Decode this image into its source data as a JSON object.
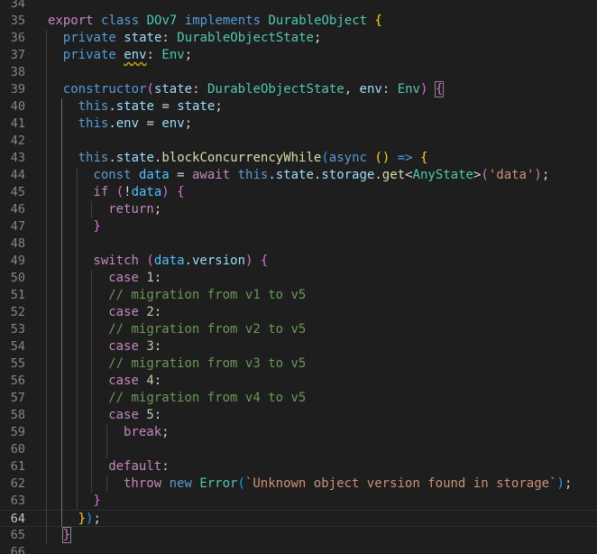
{
  "colors": {
    "background": "#1e1e1e",
    "line_number": "#858585",
    "line_number_active": "#c6c6c6",
    "keyword_blue": "#569cd6",
    "control_purple": "#c586c0",
    "type_teal": "#4ec9b0",
    "variable_lightblue": "#9cdcfe",
    "function_yellow": "#dcdcaa",
    "string_orange": "#ce9178",
    "number_green": "#b5cea8",
    "comment_green": "#6a9955",
    "bracket_gold": "#ffd700",
    "bracket_pink": "#da70d6",
    "bracket_blue": "#179fff",
    "plain": "#d4d4d4",
    "warning_squiggle": "#cca700"
  },
  "editor": {
    "active_line": 64,
    "lines": [
      {
        "n": "34",
        "indent": 0,
        "tokens": []
      },
      {
        "n": "35",
        "indent": 0,
        "tokens": [
          {
            "t": "export",
            "c": "#c586c0"
          },
          {
            "t": " ",
            "c": "#d4d4d4"
          },
          {
            "t": "class",
            "c": "#569cd6"
          },
          {
            "t": " ",
            "c": "#d4d4d4"
          },
          {
            "t": "DOv7",
            "c": "#4ec9b0"
          },
          {
            "t": " ",
            "c": "#d4d4d4"
          },
          {
            "t": "implements",
            "c": "#569cd6"
          },
          {
            "t": " ",
            "c": "#d4d4d4"
          },
          {
            "t": "DurableObject",
            "c": "#4ec9b0"
          },
          {
            "t": " ",
            "c": "#d4d4d4"
          },
          {
            "t": "{",
            "c": "#ffd700"
          }
        ]
      },
      {
        "n": "36",
        "indent": 1,
        "tokens": [
          {
            "t": "private",
            "c": "#569cd6"
          },
          {
            "t": " ",
            "c": "#d4d4d4"
          },
          {
            "t": "state",
            "c": "#9cdcfe"
          },
          {
            "t": ": ",
            "c": "#d4d4d4"
          },
          {
            "t": "DurableObjectState",
            "c": "#4ec9b0"
          },
          {
            "t": ";",
            "c": "#d4d4d4"
          }
        ]
      },
      {
        "n": "37",
        "indent": 1,
        "tokens": [
          {
            "t": "private",
            "c": "#569cd6"
          },
          {
            "t": " ",
            "c": "#d4d4d4"
          },
          {
            "t": "env",
            "c": "#9cdcfe",
            "squiggle": true
          },
          {
            "t": ": ",
            "c": "#d4d4d4"
          },
          {
            "t": "Env",
            "c": "#4ec9b0"
          },
          {
            "t": ";",
            "c": "#d4d4d4"
          }
        ]
      },
      {
        "n": "38",
        "indent": 1,
        "tokens": []
      },
      {
        "n": "39",
        "indent": 1,
        "tokens": [
          {
            "t": "constructor",
            "c": "#569cd6"
          },
          {
            "t": "(",
            "c": "#da70d6"
          },
          {
            "t": "state",
            "c": "#9cdcfe"
          },
          {
            "t": ": ",
            "c": "#d4d4d4"
          },
          {
            "t": "DurableObjectState",
            "c": "#4ec9b0"
          },
          {
            "t": ", ",
            "c": "#d4d4d4"
          },
          {
            "t": "env",
            "c": "#9cdcfe"
          },
          {
            "t": ": ",
            "c": "#d4d4d4"
          },
          {
            "t": "Env",
            "c": "#4ec9b0"
          },
          {
            "t": ")",
            "c": "#da70d6"
          },
          {
            "t": " ",
            "c": "#d4d4d4"
          },
          {
            "t": "{",
            "c": "#da70d6",
            "match": true
          }
        ]
      },
      {
        "n": "40",
        "indent": 2,
        "tokens": [
          {
            "t": "this",
            "c": "#569cd6"
          },
          {
            "t": ".",
            "c": "#d4d4d4"
          },
          {
            "t": "state",
            "c": "#9cdcfe"
          },
          {
            "t": " = ",
            "c": "#d4d4d4"
          },
          {
            "t": "state",
            "c": "#9cdcfe"
          },
          {
            "t": ";",
            "c": "#d4d4d4"
          }
        ]
      },
      {
        "n": "41",
        "indent": 2,
        "tokens": [
          {
            "t": "this",
            "c": "#569cd6"
          },
          {
            "t": ".",
            "c": "#d4d4d4"
          },
          {
            "t": "env",
            "c": "#9cdcfe"
          },
          {
            "t": " = ",
            "c": "#d4d4d4"
          },
          {
            "t": "env",
            "c": "#9cdcfe"
          },
          {
            "t": ";",
            "c": "#d4d4d4"
          }
        ]
      },
      {
        "n": "42",
        "indent": 2,
        "tokens": []
      },
      {
        "n": "43",
        "indent": 2,
        "tokens": [
          {
            "t": "this",
            "c": "#569cd6"
          },
          {
            "t": ".",
            "c": "#d4d4d4"
          },
          {
            "t": "state",
            "c": "#9cdcfe"
          },
          {
            "t": ".",
            "c": "#d4d4d4"
          },
          {
            "t": "blockConcurrencyWhile",
            "c": "#dcdcaa"
          },
          {
            "t": "(",
            "c": "#179fff"
          },
          {
            "t": "async",
            "c": "#569cd6"
          },
          {
            "t": " ",
            "c": "#d4d4d4"
          },
          {
            "t": "()",
            "c": "#ffd700"
          },
          {
            "t": " ",
            "c": "#d4d4d4"
          },
          {
            "t": "=>",
            "c": "#569cd6"
          },
          {
            "t": " ",
            "c": "#d4d4d4"
          },
          {
            "t": "{",
            "c": "#ffd700"
          }
        ]
      },
      {
        "n": "44",
        "indent": 3,
        "tokens": [
          {
            "t": "const",
            "c": "#569cd6"
          },
          {
            "t": " ",
            "c": "#d4d4d4"
          },
          {
            "t": "data",
            "c": "#4fc1ff"
          },
          {
            "t": " = ",
            "c": "#d4d4d4"
          },
          {
            "t": "await",
            "c": "#c586c0"
          },
          {
            "t": " ",
            "c": "#d4d4d4"
          },
          {
            "t": "this",
            "c": "#569cd6"
          },
          {
            "t": ".",
            "c": "#d4d4d4"
          },
          {
            "t": "state",
            "c": "#9cdcfe"
          },
          {
            "t": ".",
            "c": "#d4d4d4"
          },
          {
            "t": "storage",
            "c": "#9cdcfe"
          },
          {
            "t": ".",
            "c": "#d4d4d4"
          },
          {
            "t": "get",
            "c": "#dcdcaa"
          },
          {
            "t": "<",
            "c": "#d4d4d4"
          },
          {
            "t": "AnyState",
            "c": "#4ec9b0"
          },
          {
            "t": ">",
            "c": "#d4d4d4"
          },
          {
            "t": "(",
            "c": "#da70d6"
          },
          {
            "t": "'data'",
            "c": "#ce9178"
          },
          {
            "t": ")",
            "c": "#da70d6"
          },
          {
            "t": ";",
            "c": "#d4d4d4"
          }
        ]
      },
      {
        "n": "45",
        "indent": 3,
        "tokens": [
          {
            "t": "if",
            "c": "#c586c0"
          },
          {
            "t": " ",
            "c": "#d4d4d4"
          },
          {
            "t": "(",
            "c": "#da70d6"
          },
          {
            "t": "!",
            "c": "#d4d4d4"
          },
          {
            "t": "data",
            "c": "#4fc1ff"
          },
          {
            "t": ")",
            "c": "#da70d6"
          },
          {
            "t": " ",
            "c": "#d4d4d4"
          },
          {
            "t": "{",
            "c": "#da70d6"
          }
        ]
      },
      {
        "n": "46",
        "indent": 4,
        "tokens": [
          {
            "t": "return",
            "c": "#c586c0"
          },
          {
            "t": ";",
            "c": "#d4d4d4"
          }
        ]
      },
      {
        "n": "47",
        "indent": 3,
        "tokens": [
          {
            "t": "}",
            "c": "#da70d6"
          }
        ]
      },
      {
        "n": "48",
        "indent": 3,
        "tokens": []
      },
      {
        "n": "49",
        "indent": 3,
        "tokens": [
          {
            "t": "switch",
            "c": "#c586c0"
          },
          {
            "t": " ",
            "c": "#d4d4d4"
          },
          {
            "t": "(",
            "c": "#da70d6"
          },
          {
            "t": "data",
            "c": "#4fc1ff"
          },
          {
            "t": ".",
            "c": "#d4d4d4"
          },
          {
            "t": "version",
            "c": "#9cdcfe"
          },
          {
            "t": ")",
            "c": "#da70d6"
          },
          {
            "t": " ",
            "c": "#d4d4d4"
          },
          {
            "t": "{",
            "c": "#da70d6"
          }
        ]
      },
      {
        "n": "50",
        "indent": 4,
        "tokens": [
          {
            "t": "case",
            "c": "#c586c0"
          },
          {
            "t": " ",
            "c": "#d4d4d4"
          },
          {
            "t": "1",
            "c": "#b5cea8"
          },
          {
            "t": ":",
            "c": "#d4d4d4"
          }
        ]
      },
      {
        "n": "51",
        "indent": 4,
        "tokens": [
          {
            "t": "// migration from v1 to v5",
            "c": "#6a9955"
          }
        ]
      },
      {
        "n": "52",
        "indent": 4,
        "tokens": [
          {
            "t": "case",
            "c": "#c586c0"
          },
          {
            "t": " ",
            "c": "#d4d4d4"
          },
          {
            "t": "2",
            "c": "#b5cea8"
          },
          {
            "t": ":",
            "c": "#d4d4d4"
          }
        ]
      },
      {
        "n": "53",
        "indent": 4,
        "tokens": [
          {
            "t": "// migration from v2 to v5",
            "c": "#6a9955"
          }
        ]
      },
      {
        "n": "54",
        "indent": 4,
        "tokens": [
          {
            "t": "case",
            "c": "#c586c0"
          },
          {
            "t": " ",
            "c": "#d4d4d4"
          },
          {
            "t": "3",
            "c": "#b5cea8"
          },
          {
            "t": ":",
            "c": "#d4d4d4"
          }
        ]
      },
      {
        "n": "55",
        "indent": 4,
        "tokens": [
          {
            "t": "// migration from v3 to v5",
            "c": "#6a9955"
          }
        ]
      },
      {
        "n": "56",
        "indent": 4,
        "tokens": [
          {
            "t": "case",
            "c": "#c586c0"
          },
          {
            "t": " ",
            "c": "#d4d4d4"
          },
          {
            "t": "4",
            "c": "#b5cea8"
          },
          {
            "t": ":",
            "c": "#d4d4d4"
          }
        ]
      },
      {
        "n": "57",
        "indent": 4,
        "tokens": [
          {
            "t": "// migration from v4 to v5",
            "c": "#6a9955"
          }
        ]
      },
      {
        "n": "58",
        "indent": 4,
        "tokens": [
          {
            "t": "case",
            "c": "#c586c0"
          },
          {
            "t": " ",
            "c": "#d4d4d4"
          },
          {
            "t": "5",
            "c": "#b5cea8"
          },
          {
            "t": ":",
            "c": "#d4d4d4"
          }
        ]
      },
      {
        "n": "59",
        "indent": 5,
        "tokens": [
          {
            "t": "break",
            "c": "#c586c0"
          },
          {
            "t": ";",
            "c": "#d4d4d4"
          }
        ]
      },
      {
        "n": "60",
        "indent": 5,
        "tokens": []
      },
      {
        "n": "61",
        "indent": 4,
        "tokens": [
          {
            "t": "default",
            "c": "#c586c0"
          },
          {
            "t": ":",
            "c": "#d4d4d4"
          }
        ]
      },
      {
        "n": "62",
        "indent": 5,
        "tokens": [
          {
            "t": "throw",
            "c": "#c586c0"
          },
          {
            "t": " ",
            "c": "#d4d4d4"
          },
          {
            "t": "new",
            "c": "#569cd6"
          },
          {
            "t": " ",
            "c": "#d4d4d4"
          },
          {
            "t": "Error",
            "c": "#4ec9b0"
          },
          {
            "t": "(",
            "c": "#179fff"
          },
          {
            "t": "`Unknown object version found in storage`",
            "c": "#ce9178"
          },
          {
            "t": ")",
            "c": "#179fff"
          },
          {
            "t": ";",
            "c": "#d4d4d4"
          }
        ]
      },
      {
        "n": "63",
        "indent": 3,
        "tokens": [
          {
            "t": "}",
            "c": "#da70d6"
          }
        ]
      },
      {
        "n": "64",
        "indent": 2,
        "tokens": [
          {
            "t": "}",
            "c": "#ffd700"
          },
          {
            "t": ")",
            "c": "#179fff"
          },
          {
            "t": ";",
            "c": "#d4d4d4"
          }
        ]
      },
      {
        "n": "65",
        "indent": 1,
        "tokens": [
          {
            "t": "}",
            "c": "#da70d6",
            "match": true
          }
        ]
      },
      {
        "n": "66",
        "indent": 0,
        "tokens": []
      }
    ]
  }
}
